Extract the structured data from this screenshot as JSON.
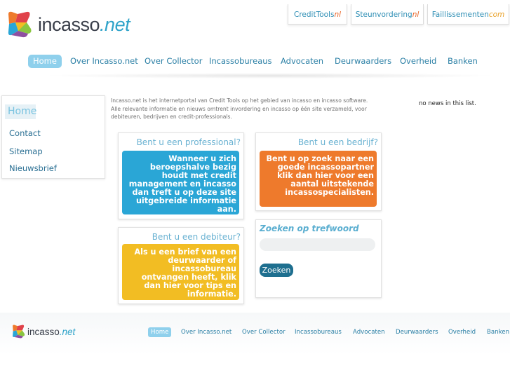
{
  "logo": {
    "name": "incasso",
    "tld": ".net",
    "footer_name": "incasso",
    "footer_tld": ".net"
  },
  "top_tabs": [
    {
      "base": "CreditTools",
      "suffix": "nl",
      "suffix_color": "#e9672a"
    },
    {
      "base": "Steunvordering",
      "suffix": "nl",
      "suffix_color": "#e9672a"
    },
    {
      "base": "Faillissementen",
      "suffix": "com",
      "suffix_color": "#e9a22a"
    }
  ],
  "nav": [
    "Home",
    "Over Incasso.net",
    "Over Collector",
    "Incassobureaus",
    "Advocaten",
    "Deurwaarders",
    "Overheid",
    "Banken"
  ],
  "sidebar": {
    "home": "Home",
    "items": [
      "Contact",
      "Sitemap",
      "Nieuwsbrief"
    ]
  },
  "intro": {
    "line1": "Incasso.net is het internetportal van Credit Tools op het gebied van incasso en incasso software.",
    "line2": "Alle relevante informatie en nieuws omtrent invordering en incasso op één site verzameld, voor",
    "line3": "debiteuren, bedrijven en credit-professionals."
  },
  "news": "no news in this list.",
  "cards": {
    "professional": {
      "title": "Bent u een professional?",
      "text": "Wanneer u zich beroepshalve bezig houdt met credit management en incasso dan treft u op deze site uitgebreide informatie aan."
    },
    "bedrijf": {
      "title": "Bent u een bedrijf?",
      "text": "Bent u op zoek naar een goede incassopartner klik dan hier voor een aantal uitstekende incassospecialisten."
    },
    "debiteur": {
      "title": "Bent u een debiteur?",
      "text": "Als u een brief van een deurwaarder of incassobureau ontvangen heeft, klik dan hier voor tips en informatie."
    }
  },
  "search": {
    "title": "Zoeken op trefwoord",
    "placeholder": "",
    "button": "Zoeken"
  },
  "colors": {
    "accent": "#2aa6d6",
    "orange": "#ee7a2c",
    "yellow": "#f2bd23",
    "nav_active": "#8fd0ec",
    "button": "#1e6f8f"
  }
}
